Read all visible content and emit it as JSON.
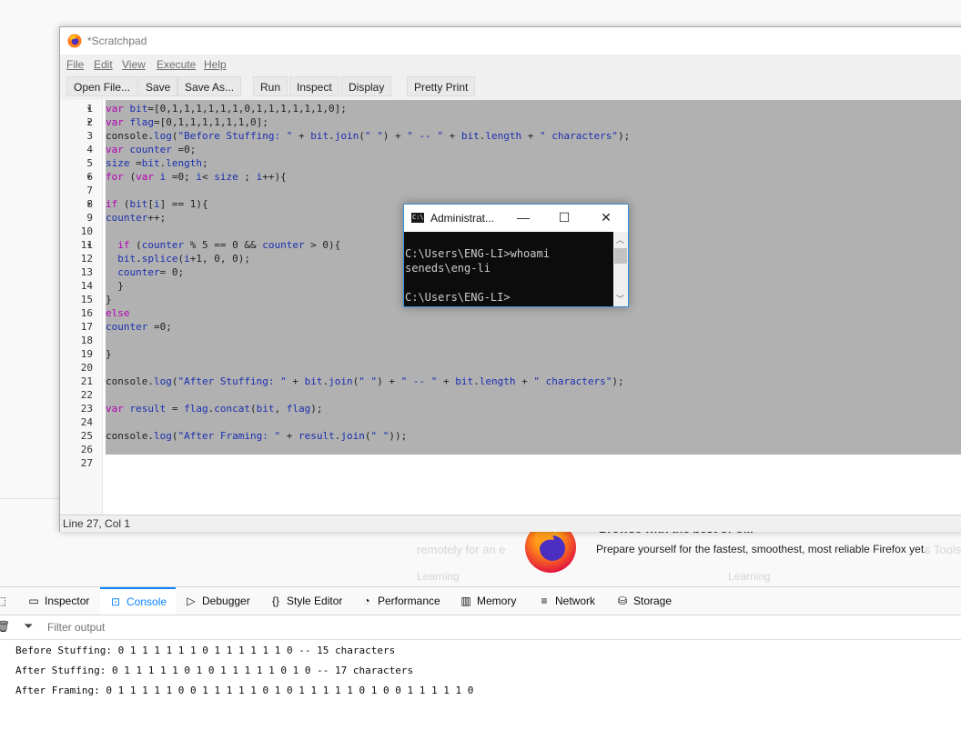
{
  "background": {
    "headline": "Browse with the best of C...",
    "faded_left": "remotely for an e",
    "tagline": "Prepare yourself for the fastest, smoothest, most reliable Firefox yet.",
    "faded_right": "s Tools",
    "faded_row2a": "Learning",
    "faded_row2b": "Learning"
  },
  "devtools": {
    "tabs": [
      {
        "label": "Inspector",
        "icon": "inspector-icon"
      },
      {
        "label": "Console",
        "icon": "console-icon"
      },
      {
        "label": "Debugger",
        "icon": "debugger-icon"
      },
      {
        "label": "Style Editor",
        "icon": "style-editor-icon"
      },
      {
        "label": "Performance",
        "icon": "performance-icon"
      },
      {
        "label": "Memory",
        "icon": "memory-icon"
      },
      {
        "label": "Network",
        "icon": "network-icon"
      },
      {
        "label": "Storage",
        "icon": "storage-icon"
      }
    ],
    "active_tab": "Console",
    "filter_placeholder": "Filter output",
    "output": [
      "Before Stuffing: 0 1 1 1 1 1 1 0 1 1 1 1 1 1 0 -- 15 characters",
      "After Stuffing: 0 1 1 1 1 1 0 1 0 1 1 1 1 1 0 1 0 -- 17 characters",
      "After Framing: 0 1 1 1 1 1 0 0 1 1 1 1 1 0 1 0 1 1 1 1 1 0 1 0 0 1 1 1 1 1 0"
    ]
  },
  "scratchpad": {
    "title": "*Scratchpad",
    "menu": [
      "File",
      "Edit",
      "View",
      "Execute",
      "Help"
    ],
    "toolbar": [
      "Open File...",
      "Save",
      "Save As...",
      "Run",
      "Inspect",
      "Display",
      "Pretty Print"
    ],
    "lines": [
      "var bit=[0,1,1,1,1,1,1,0,1,1,1,1,1,1,0];",
      "var flag=[0,1,1,1,1,1,1,0];",
      "console.log(\"Before Stuffing: \" + bit.join(\" \") + \" -- \" + bit.length + \" characters\");",
      "var counter =0;",
      "size =bit.length;",
      "for (var i =0; i< size ; i++){",
      "",
      "if (bit[i] == 1){",
      "counter++;",
      "",
      "  if (counter % 5 == 0 && counter > 0){",
      "  bit.splice(i+1, 0, 0);",
      "  counter= 0;",
      "  }",
      "}",
      "else",
      "counter =0;",
      "",
      "}",
      "",
      "console.log(\"After Stuffing: \" + bit.join(\" \") + \" -- \" + bit.length + \" characters\");",
      "",
      "var result = flag.concat(bit, flag);",
      "",
      "console.log(\"After Framing: \" + result.join(\" \"));",
      "",
      ""
    ],
    "status": "Line 27, Col 1"
  },
  "cmd": {
    "title": "Administrat...",
    "lines": [
      "C:\\Users\\ENG-LI>whoami",
      "seneds\\eng-li",
      "",
      "C:\\Users\\ENG-LI>"
    ]
  }
}
